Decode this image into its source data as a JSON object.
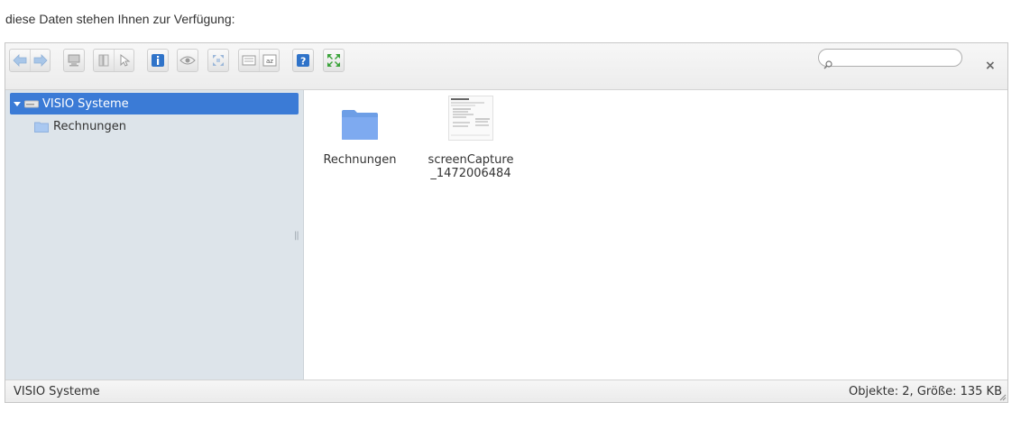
{
  "intro_text": "diese Daten stehen Ihnen zur Verfügung:",
  "search": {
    "value": "",
    "placeholder": ""
  },
  "toolbar": {
    "icons": [
      "back-icon",
      "forward-icon",
      "home-icon",
      "view-icon",
      "select-icon",
      "info-icon",
      "preview-icon",
      "fullscreen-icon",
      "list-view-icon",
      "sort-icon",
      "help-icon",
      "expand-icon"
    ]
  },
  "close_label": "×",
  "tree": {
    "root_label": "VISIO Systeme",
    "children": [
      {
        "label": "Rechnungen"
      }
    ]
  },
  "files": [
    {
      "name": "Rechnungen",
      "type": "folder"
    },
    {
      "name": "screenCapture _1472006484",
      "type": "image"
    }
  ],
  "statusbar": {
    "path": "VISIO Systeme",
    "info": "Objekte: 2, Größe: 135 KB"
  },
  "colors": {
    "selection": "#3b7bd6",
    "tree_bg": "#dde4ea",
    "folder": "#6d9ee6"
  }
}
